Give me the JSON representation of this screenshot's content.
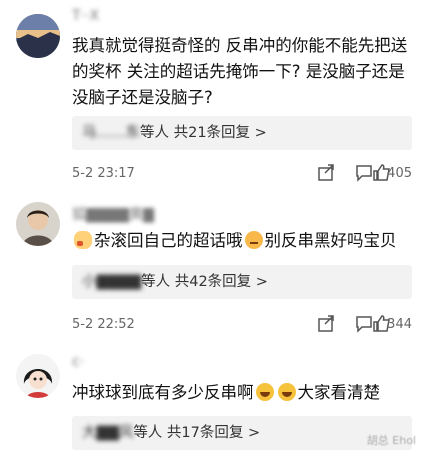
{
  "comments": [
    {
      "username": "T··X",
      "text": "我真就觉得挺奇怪的 反串冲的你能不能先把送的奖杯 关注的超话先掩饰一下? 是没脑子还是没脑子还是没脑子?",
      "reply_names": "马……东",
      "reply_suffix": "等人",
      "reply_count": "共21条回复 >",
      "time": "5-2 23:17",
      "likes": "405"
    },
    {
      "username": "狐▇▇▇▇黄▇",
      "text_parts": [
        "杂滚回自己的超话哦",
        "别反串黑好吗宝贝"
      ],
      "reply_names": "小▇▇▇▇",
      "reply_suffix": "等人",
      "reply_count": "共42条回复 >",
      "time": "5-2 22:52",
      "likes": "344"
    },
    {
      "username": "c·",
      "text_parts": [
        "冲球球到底有多少反串啊",
        "大家看清楚"
      ],
      "reply_names": "大▇▇风",
      "reply_suffix": "等人",
      "reply_count": "共17条回复 >",
      "time": "",
      "likes": ""
    }
  ],
  "watermark": "胡总 Ehol",
  "icons": {
    "share": "share-icon",
    "comment": "comment-icon",
    "like": "thumbs-up-icon"
  }
}
